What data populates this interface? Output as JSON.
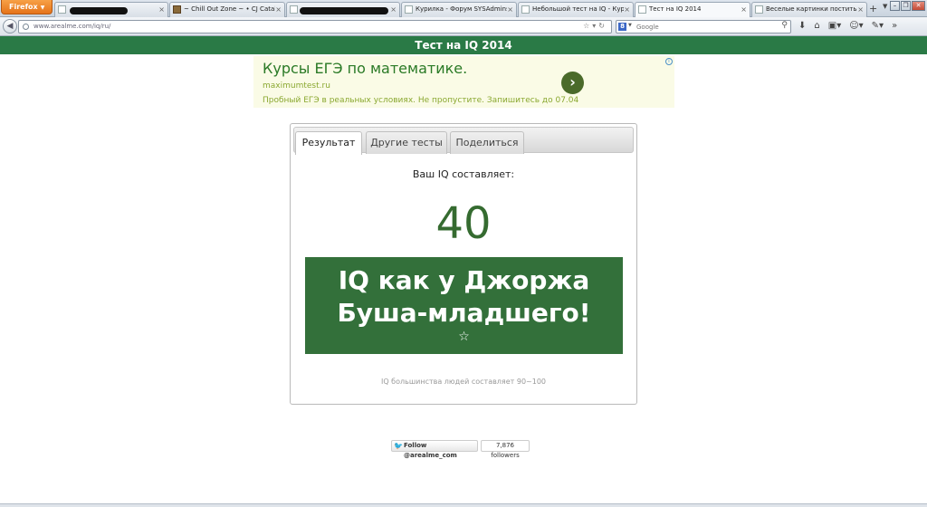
{
  "browser": {
    "menu_button_label": "Firefox",
    "tabs": [
      {
        "label": "~ Chill Out Zone ~ • CJ Cataliz...",
        "close": "×"
      },
      {
        "label": "Курилка - Форум SYSAdmins....",
        "close": "×"
      },
      {
        "label": "Небольшой тест на IQ - Кури...",
        "close": "×"
      },
      {
        "label": "Тест на IQ 2014",
        "close": "×"
      },
      {
        "label": "Веселые картинки постить с...",
        "close": "×"
      }
    ],
    "new_tab": "+",
    "url": "www.arealme.com/iq/ru/",
    "search_engine_letter": "8",
    "search_placeholder": "Google"
  },
  "page": {
    "header_title": "Тест на IQ 2014",
    "ad": {
      "title": "Курсы ЕГЭ по математике.",
      "url": "maximumtest.ru",
      "description": "Пробный ЕГЭ в реальных условиях. Не пропустите. Запишитесь до 07.04"
    },
    "tabs": [
      {
        "label": "Результат"
      },
      {
        "label": "Другие тесты"
      },
      {
        "label": "Поделиться"
      }
    ],
    "result": {
      "caption": "Ваш IQ составляет:",
      "score": "40",
      "verdict_line1": "IQ как у Джоржа",
      "verdict_line2": "Буша-младшего!",
      "star": "☆",
      "footnote": "IQ большинства людей составляет 90~100"
    },
    "twitter": {
      "follow_label": "Follow @arealme_com",
      "followers": "7,876 followers"
    }
  },
  "colors": {
    "brand_green": "#2a7a46",
    "verdict_green": "#33703a",
    "score_green": "#356b30",
    "ad_bg": "#fafbe6"
  }
}
